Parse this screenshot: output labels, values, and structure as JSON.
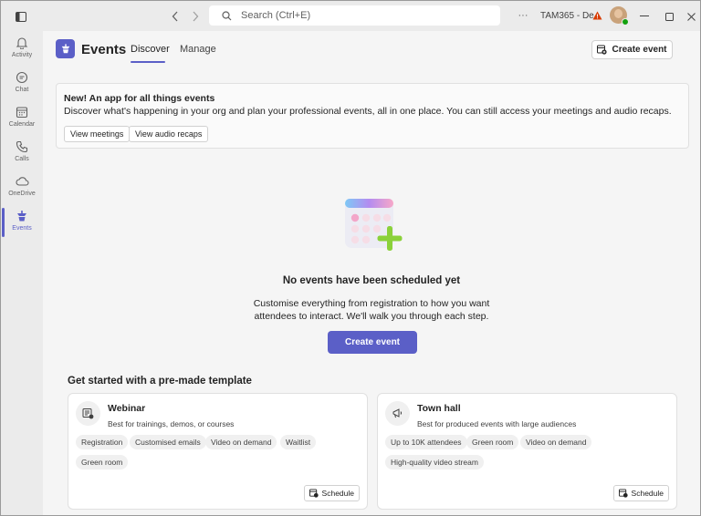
{
  "titlebar": {
    "search_placeholder": "Search (Ctrl+E)",
    "tenant": "TAM365 - De...",
    "more_label": "···"
  },
  "rail": {
    "items": [
      {
        "label": "Activity",
        "icon": "bell-icon"
      },
      {
        "label": "Chat",
        "icon": "chat-icon"
      },
      {
        "label": "Calendar",
        "icon": "calendar-icon"
      },
      {
        "label": "Calls",
        "icon": "phone-icon"
      },
      {
        "label": "OneDrive",
        "icon": "cloud-icon"
      },
      {
        "label": "Events",
        "icon": "events-icon",
        "active": true
      }
    ]
  },
  "header": {
    "title": "Events",
    "tabs": [
      {
        "label": "Discover",
        "active": true
      },
      {
        "label": "Manage",
        "active": false
      }
    ],
    "create_button": "Create event"
  },
  "banner": {
    "title": "New! An app for all things events",
    "description": "Discover what's happening in your org and plan your professional events, all in one place. You can still access your meetings and audio recaps.",
    "buttons": [
      "View meetings",
      "View audio recaps"
    ]
  },
  "empty_state": {
    "title": "No events have been scheduled yet",
    "description": "Customise everything from registration to how you want attendees to interact. We'll walk you through each step.",
    "button": "Create event"
  },
  "templates": {
    "section_title": "Get started with a pre-made template",
    "cards": [
      {
        "title": "Webinar",
        "subtitle": "Best for trainings, demos, or courses",
        "tags": [
          "Registration",
          "Customised emails",
          "Video on demand",
          "Waitlist",
          "Green room"
        ],
        "schedule_label": "Schedule",
        "icon": "webinar-icon"
      },
      {
        "title": "Town hall",
        "subtitle": "Best for produced events with large audiences",
        "tags": [
          "Up to 10K attendees",
          "Green room",
          "Video on demand",
          "High-quality video stream"
        ],
        "schedule_label": "Schedule",
        "icon": "megaphone-icon"
      }
    ]
  },
  "colors": {
    "accent": "#5b5fc7",
    "warning": "#d83b01",
    "presence": "#13a10e"
  }
}
